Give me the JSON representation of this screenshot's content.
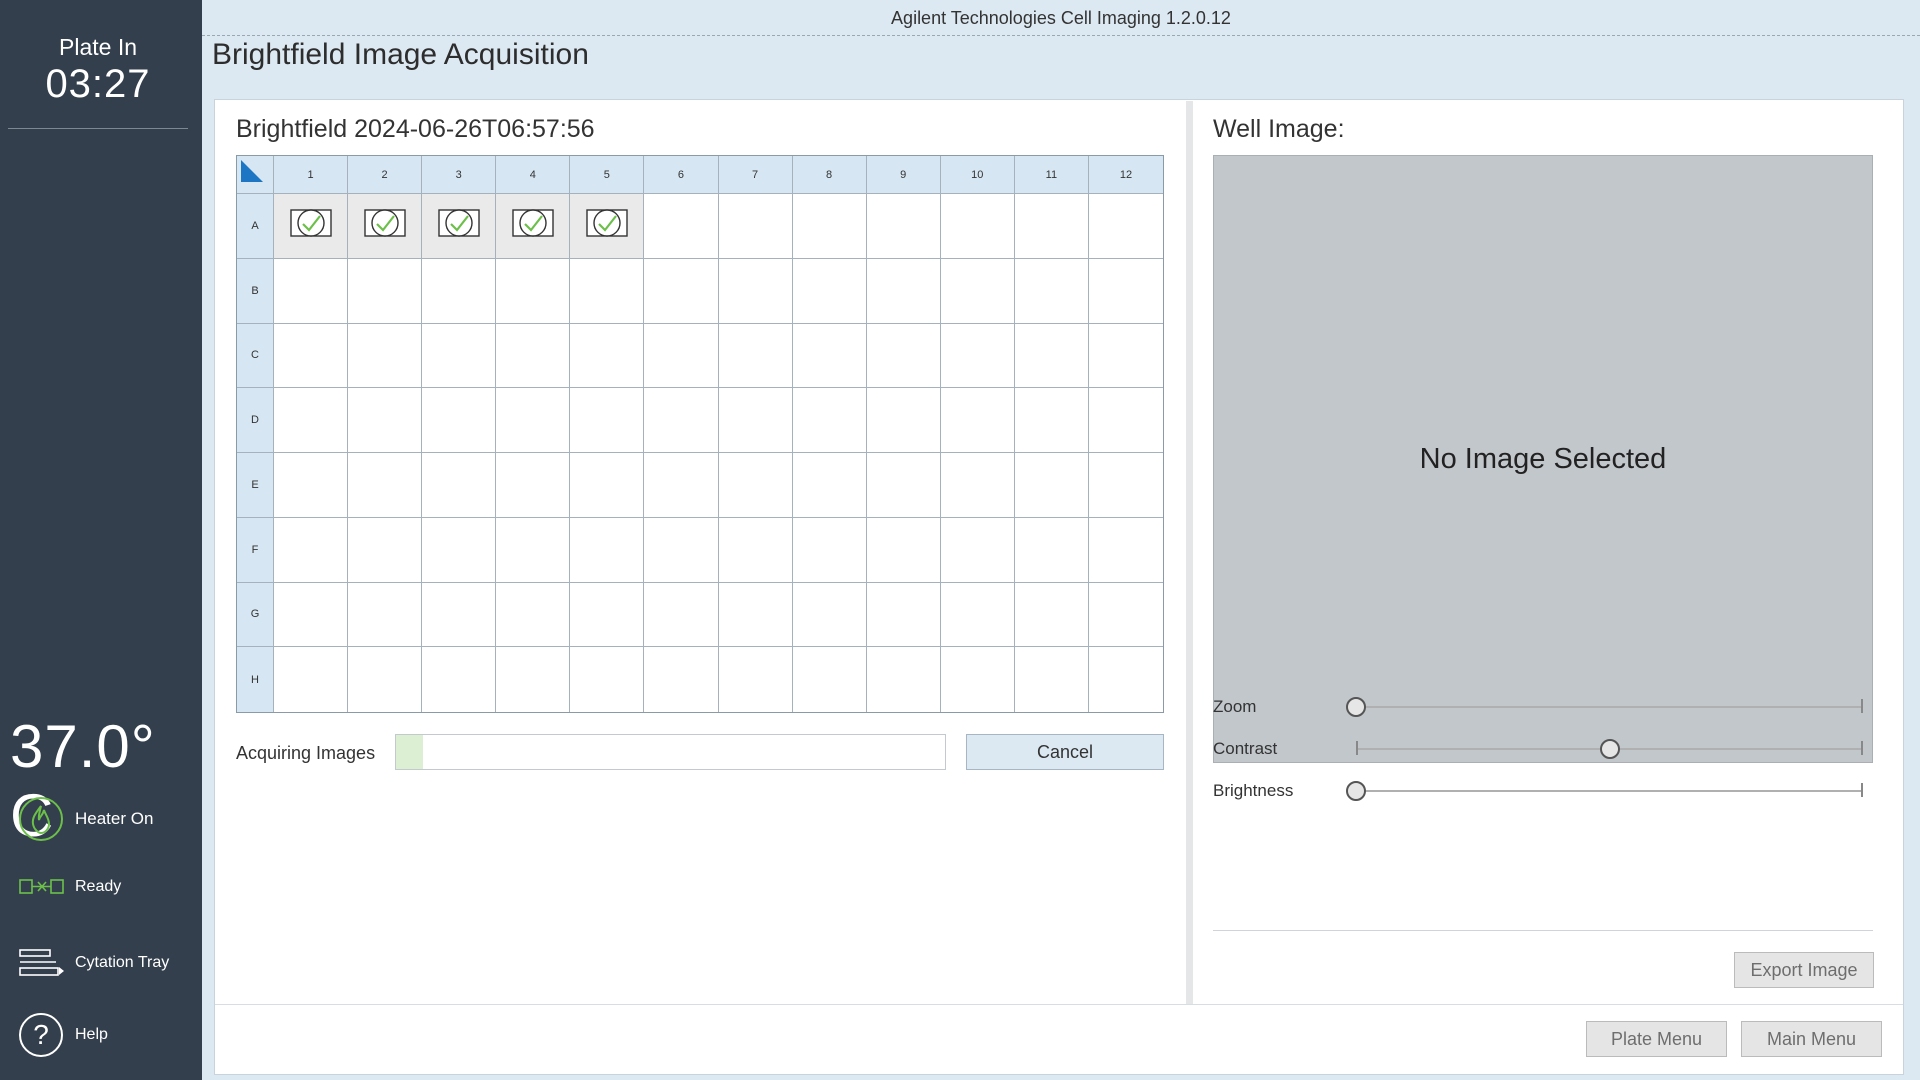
{
  "app_title": "Agilent Technologies Cell Imaging 1.2.0.12",
  "page_title": "Brightfield Image Acquisition",
  "sidebar": {
    "plate_label": "Plate In",
    "timer": "03:27",
    "temperature": "37.0° C",
    "items": [
      {
        "label": "Heater On",
        "icon": "flame-icon"
      },
      {
        "label": "Ready",
        "icon": "connection-ready-icon"
      },
      {
        "label": "Cytation Tray",
        "icon": "tray-icon"
      },
      {
        "label": "Help",
        "icon": "help-icon"
      }
    ]
  },
  "experiment": {
    "title": "Brightfield 2024-06-26T06:57:56",
    "columns": [
      "1",
      "2",
      "3",
      "4",
      "5",
      "6",
      "7",
      "8",
      "9",
      "10",
      "11",
      "12"
    ],
    "rows": [
      "A",
      "B",
      "C",
      "D",
      "E",
      "F",
      "G",
      "H"
    ],
    "completed_wells": [
      "A1",
      "A2",
      "A3",
      "A4",
      "A5"
    ]
  },
  "acquisition": {
    "label": "Acquiring Images",
    "progress_fraction": 0.05,
    "progress_color": "#dcefd3",
    "cancel_label": "Cancel"
  },
  "well_image": {
    "title": "Well Image:",
    "placeholder": "No Image Selected"
  },
  "sliders": [
    {
      "label": "Zoom",
      "value": 0.0
    },
    {
      "label": "Contrast",
      "value": 0.5
    },
    {
      "label": "Brightness",
      "value": 0.0
    }
  ],
  "buttons": {
    "export_image": "Export Image",
    "plate_menu": "Plate Menu",
    "main_menu": "Main Menu"
  },
  "colors": {
    "sidebar_bg": "#333f4c",
    "header_cell": "#d6e6f2",
    "accent_blue": "#1c76c4",
    "heater_green": "#6cc04a"
  }
}
